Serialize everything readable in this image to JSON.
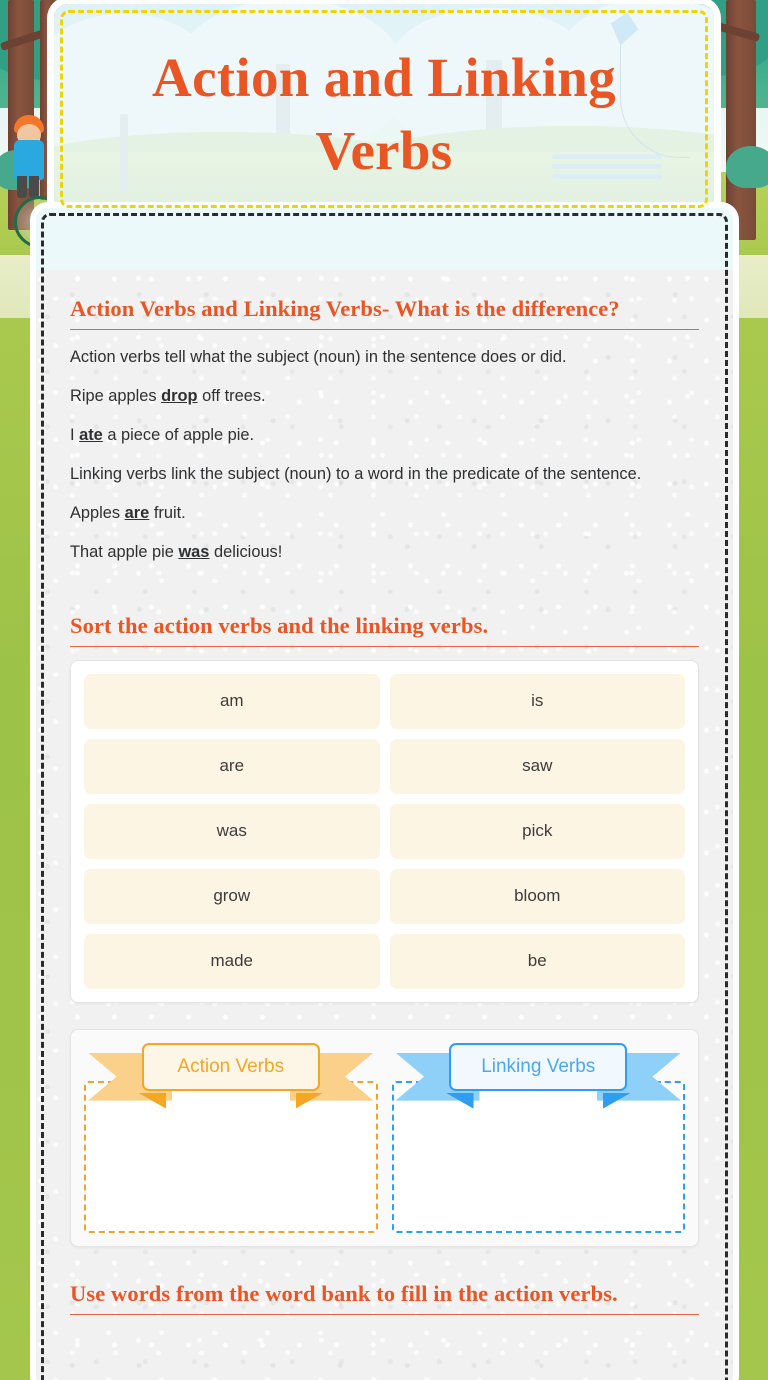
{
  "header": {
    "title": "Action and Linking Verbs"
  },
  "explanation": {
    "heading": "Action Verbs and Linking Verbs- What is the difference?",
    "lines": [
      {
        "before": "Action verbs tell what the subject (noun) in the sentence does or did.",
        "bold": "",
        "after": ""
      },
      {
        "before": "Ripe apples ",
        "bold": "drop",
        "after": " off trees."
      },
      {
        "before": "I ",
        "bold": "ate",
        "after": " a piece of apple pie."
      },
      {
        "before": "Linking verbs link the subject (noun) to a word in the predicate of the sentence.",
        "bold": "",
        "after": ""
      },
      {
        "before": "Apples ",
        "bold": "are",
        "after": " fruit."
      },
      {
        "before": "That apple pie ",
        "bold": "was",
        "after": " delicious!"
      }
    ]
  },
  "sort_activity": {
    "heading": "Sort the action verbs and the linking verbs.",
    "tiles": [
      "am",
      "is",
      "are",
      "saw",
      "was",
      "pick",
      "grow",
      "bloom",
      "made",
      "be"
    ],
    "dropzones": [
      {
        "label": "Action Verbs",
        "color": "#f5a623"
      },
      {
        "label": "Linking Verbs",
        "color": "#2f9ef0"
      }
    ]
  },
  "wordbank_activity": {
    "heading": "Use words from the word bank to fill in the action verbs."
  },
  "colors": {
    "heading_orange": "#ea5524",
    "tile_cream": "#fdf5e4",
    "action_orange": "#f5a623",
    "linking_blue": "#2f9ef0",
    "header_dash_yellow": "#f0d400"
  }
}
